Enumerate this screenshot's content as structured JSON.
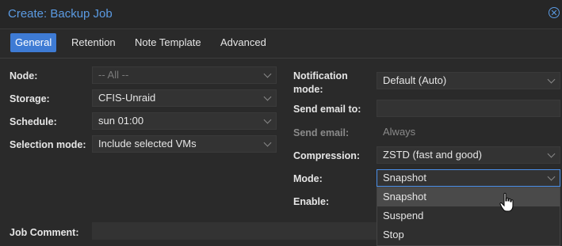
{
  "window": {
    "title": "Create: Backup Job"
  },
  "tabs": [
    {
      "label": "General",
      "active": true
    },
    {
      "label": "Retention",
      "active": false
    },
    {
      "label": "Note Template",
      "active": false
    },
    {
      "label": "Advanced",
      "active": false
    }
  ],
  "left": {
    "node": {
      "label": "Node:",
      "value": "-- All --"
    },
    "storage": {
      "label": "Storage:",
      "value": "CFIS-Unraid"
    },
    "schedule": {
      "label": "Schedule:",
      "value": "sun 01:00"
    },
    "selection_mode": {
      "label": "Selection mode:",
      "value": "Include selected VMs"
    }
  },
  "right": {
    "notification_mode": {
      "label_line1": "Notification",
      "label_line2": "mode:",
      "value": "Default (Auto)"
    },
    "send_email_to": {
      "label": "Send email to:",
      "value": ""
    },
    "send_email": {
      "label": "Send email:",
      "value": "Always"
    },
    "compression": {
      "label": "Compression:",
      "value": "ZSTD (fast and good)"
    },
    "mode": {
      "label": "Mode:",
      "value": "Snapshot"
    },
    "enable": {
      "label": "Enable:"
    }
  },
  "job_comment": {
    "label": "Job Comment:",
    "value": ""
  },
  "mode_dropdown": {
    "options": [
      "Snapshot",
      "Suspend",
      "Stop"
    ],
    "hovered": "Snapshot"
  },
  "colors": {
    "accent": "#3e7bd4",
    "title": "#5b9be3",
    "background": "#2a2a2a"
  }
}
